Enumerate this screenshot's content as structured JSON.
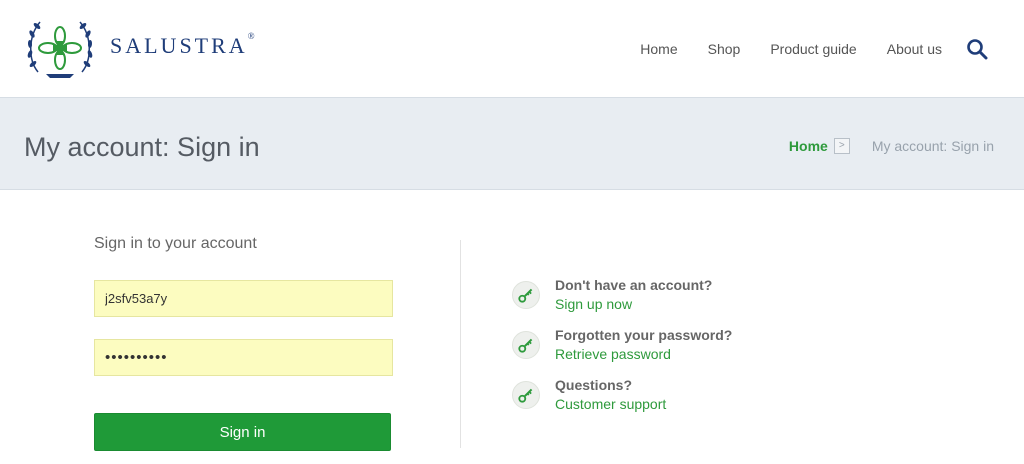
{
  "header": {
    "brand": "SALUSTRA",
    "brand_mark": "®",
    "nav": [
      "Home",
      "Shop",
      "Product guide",
      "About us"
    ]
  },
  "title_bar": {
    "title": "My account: Sign in",
    "breadcrumb_home": "Home",
    "breadcrumb_sep": ">",
    "breadcrumb_current": "My account: Sign in"
  },
  "form": {
    "heading": "Sign in to your account",
    "username_value": "j2sfv53a7y",
    "password_value": "••••••••••",
    "submit_label": "Sign in"
  },
  "help": [
    {
      "question": "Don't have an account?",
      "link": "Sign up now"
    },
    {
      "question": "Forgotten your password?",
      "link": "Retrieve password"
    },
    {
      "question": "Questions?",
      "link": "Customer support"
    }
  ],
  "colors": {
    "brand_blue": "#1f3d79",
    "accent_green": "#2e9a3c",
    "button_green": "#1f9a38",
    "field_yellow": "#fcfcc0",
    "title_bar_bg": "#e8edf2"
  }
}
